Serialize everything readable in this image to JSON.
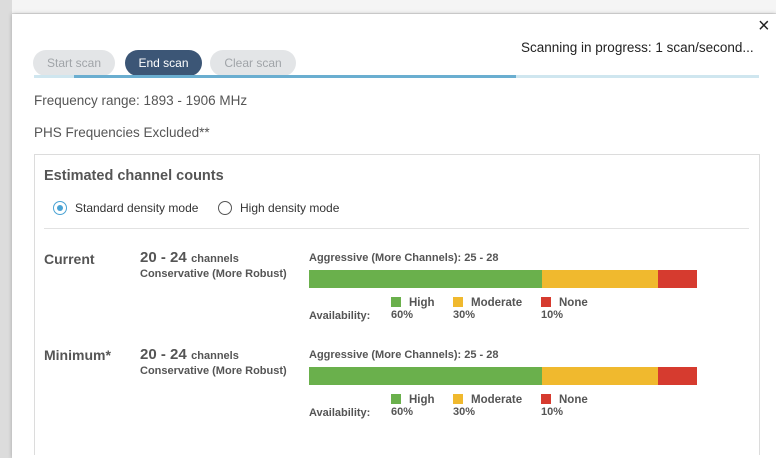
{
  "toolbar": {
    "start_label": "Start scan",
    "end_label": "End scan",
    "clear_label": "Clear scan",
    "status": "Scanning in progress: 1 scan/second...",
    "close_icon": "close-icon",
    "close_glyph": "×"
  },
  "progress": {
    "fraction": 0.61
  },
  "info": {
    "frequency_range": "Frequency range: 1893 - 1906 MHz",
    "excluded": "PHS Frequencies Excluded**"
  },
  "panel": {
    "title": "Estimated channel counts",
    "modes": [
      {
        "label": "Standard density mode",
        "selected": true
      },
      {
        "label": "High density mode",
        "selected": false
      }
    ],
    "rows": [
      {
        "label": "Current",
        "count": "20 - 24",
        "unit": "channels",
        "subtitle": "Conservative (More Robust)",
        "aggressive": "Aggressive (More Channels): 25 - 28",
        "availability_label": "Availability:",
        "legend": [
          {
            "name": "High",
            "pct": "60%",
            "value": 60,
            "color": "#6ab04c"
          },
          {
            "name": "Moderate",
            "pct": "30%",
            "value": 30,
            "color": "#f0b92e"
          },
          {
            "name": "None",
            "pct": "10%",
            "value": 10,
            "color": "#d63b2f"
          }
        ]
      },
      {
        "label": "Minimum*",
        "count": "20 - 24",
        "unit": "channels",
        "subtitle": "Conservative (More Robust)",
        "aggressive": "Aggressive (More Channels): 25 - 28",
        "availability_label": "Availability:",
        "legend": [
          {
            "name": "High",
            "pct": "60%",
            "value": 60,
            "color": "#6ab04c"
          },
          {
            "name": "Moderate",
            "pct": "30%",
            "value": 30,
            "color": "#f0b92e"
          },
          {
            "name": "None",
            "pct": "10%",
            "value": 10,
            "color": "#d63b2f"
          }
        ]
      }
    ]
  }
}
